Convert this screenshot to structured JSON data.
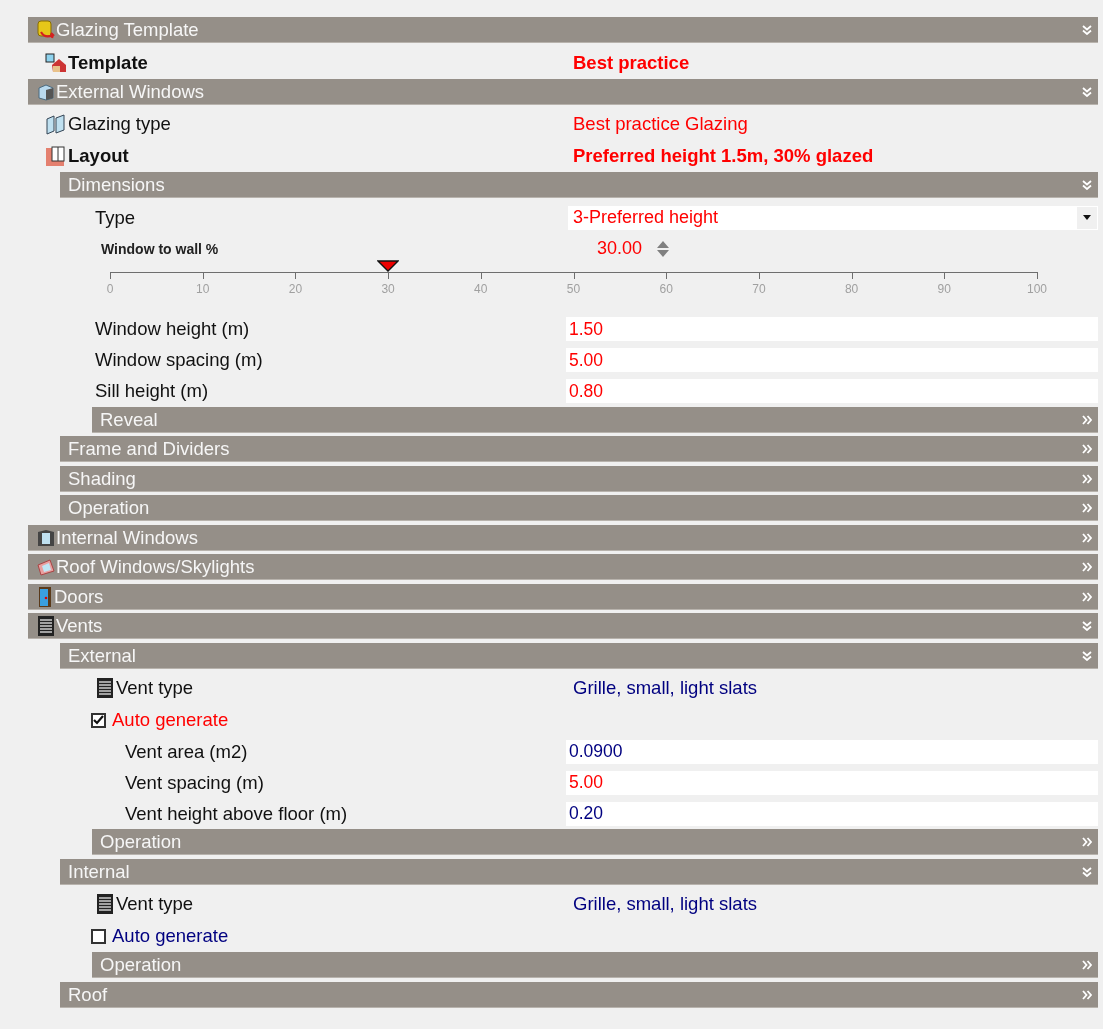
{
  "sections": [
    {
      "kind": "section",
      "title": "Glazing Template",
      "expanded": true,
      "icon": true,
      "children": [
        {
          "kind": "property",
          "label": "Template",
          "value": "Best practice",
          "bold": true,
          "icon": true,
          "color": "#ff0000"
        }
      ]
    },
    {
      "kind": "section",
      "title": "External Windows",
      "expanded": true,
      "icon": true,
      "children": [
        {
          "kind": "property",
          "label": "Glazing type",
          "value": "Best practice Glazing",
          "bold": false,
          "icon": true,
          "color": "#ff0000"
        },
        {
          "kind": "property",
          "label": "Layout",
          "value": "Preferred height 1.5m, 30% glazed",
          "bold": true,
          "icon": true,
          "color": "#ff0000"
        },
        {
          "kind": "section",
          "title": "Dimensions",
          "expanded": true,
          "children": [
            {
              "kind": "dropdown",
              "label": "Type",
              "value": "3-Preferred height",
              "color": "#ff0000"
            },
            {
              "kind": "slider",
              "label": "Window to wall %",
              "value": "30.00",
              "level": 0.3,
              "color": "#ff0000",
              "ticks": [
                "0",
                "10",
                "20",
                "30",
                "40",
                "50",
                "60",
                "70",
                "80",
                "90",
                "100"
              ]
            },
            {
              "kind": "field",
              "label": "Window height (m)",
              "value": "1.50",
              "color": "#ff0000"
            },
            {
              "kind": "field",
              "label": "Window spacing (m)",
              "value": "5.00",
              "color": "#ff0000"
            },
            {
              "kind": "field",
              "label": "Sill height (m)",
              "value": "0.80",
              "color": "#ff0000"
            },
            {
              "kind": "section",
              "title": "Reveal",
              "expanded": false
            }
          ]
        },
        {
          "kind": "section",
          "title": "Frame and Dividers",
          "expanded": false
        },
        {
          "kind": "section",
          "title": "Shading",
          "expanded": false
        },
        {
          "kind": "section",
          "title": "Operation",
          "expanded": false
        }
      ]
    },
    {
      "kind": "section",
      "title": "Internal Windows",
      "expanded": false,
      "icon": true
    },
    {
      "kind": "section",
      "title": "Roof Windows/Skylights",
      "expanded": false,
      "icon": true
    },
    {
      "kind": "section",
      "title": "Doors",
      "expanded": false,
      "icon": true
    },
    {
      "kind": "section",
      "title": "Vents",
      "expanded": true,
      "icon": true,
      "children": [
        {
          "kind": "section",
          "title": "External",
          "expanded": true,
          "children": [
            {
              "kind": "property",
              "label": "Vent type",
              "value": "Grille, small, light slats",
              "bold": false,
              "icon": true,
              "color": "#000080"
            },
            {
              "kind": "checkbox",
              "label": "Auto generate",
              "checked": true,
              "color": "#ff0000",
              "children": [
                {
                  "kind": "field",
                  "label": "Vent area (m2)",
                  "value": "0.0900",
                  "color": "#000080"
                },
                {
                  "kind": "field",
                  "label": "Vent spacing (m)",
                  "value": "5.00",
                  "color": "#ff0000"
                },
                {
                  "kind": "field",
                  "label": "Vent height above floor (m)",
                  "value": "0.20",
                  "color": "#000080"
                }
              ]
            },
            {
              "kind": "section",
              "title": "Operation",
              "expanded": false
            }
          ]
        },
        {
          "kind": "section",
          "title": "Internal",
          "expanded": true,
          "children": [
            {
              "kind": "property",
              "label": "Vent type",
              "value": "Grille, small, light slats",
              "bold": false,
              "icon": true,
              "color": "#000080"
            },
            {
              "kind": "checkbox",
              "label": "Auto generate",
              "checked": false,
              "color": "#000080"
            },
            {
              "kind": "section",
              "title": "Operation",
              "expanded": false
            }
          ]
        },
        {
          "kind": "section",
          "title": "Roof",
          "expanded": false
        }
      ]
    }
  ]
}
